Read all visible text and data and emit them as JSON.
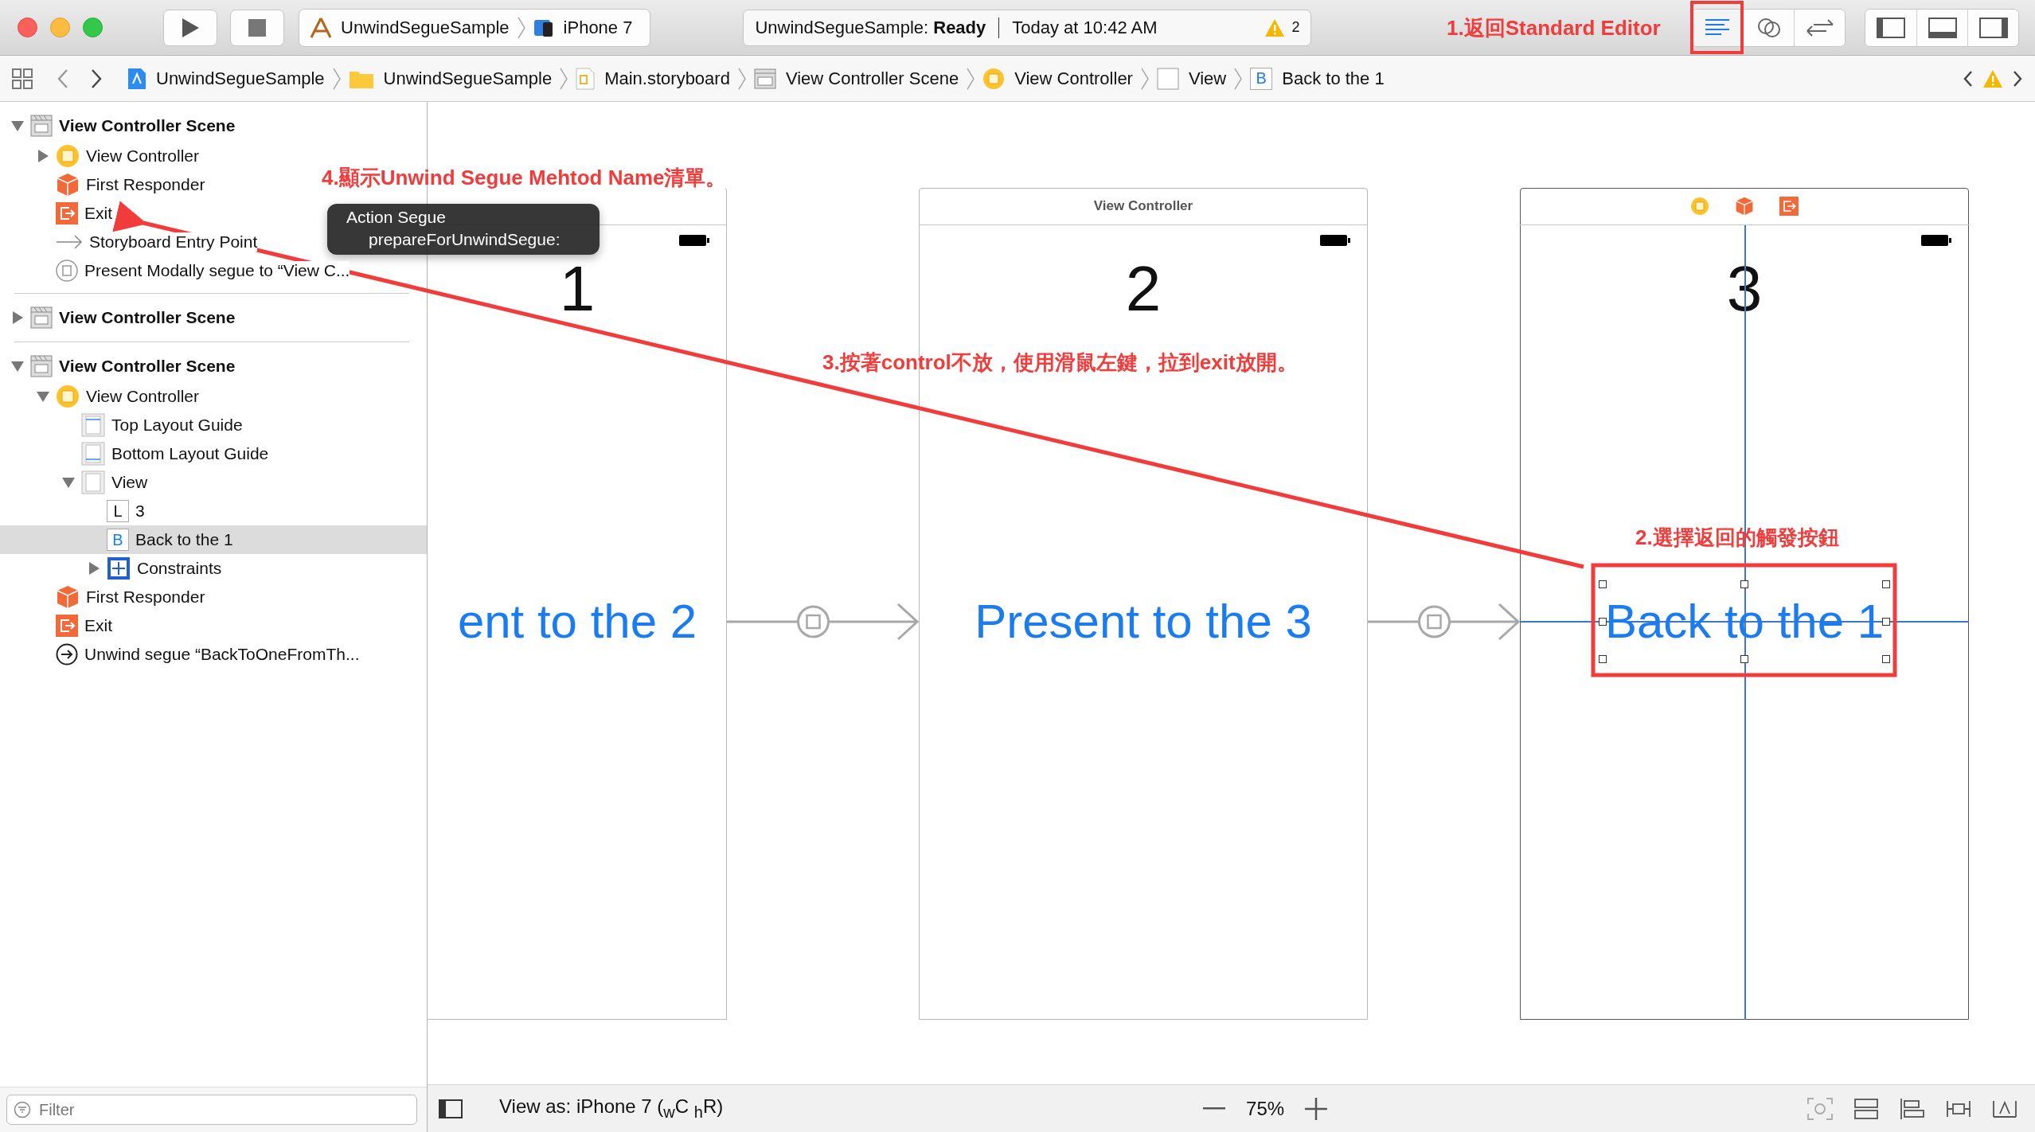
{
  "toolbar": {
    "scheme": "UnwindSegueSample",
    "device": "iPhone 7",
    "activity": {
      "project": "UnwindSegueSample:",
      "status": "Ready",
      "time": "Today at 10:42 AM",
      "warnings": "2"
    },
    "editor_modes": [
      {
        "kind": "standard",
        "selected": true
      },
      {
        "kind": "assistant",
        "selected": false
      },
      {
        "kind": "version",
        "selected": false
      }
    ]
  },
  "jump_bar": [
    {
      "kind": "project",
      "label": "UnwindSegueSample"
    },
    {
      "kind": "folder",
      "label": "UnwindSegueSample"
    },
    {
      "kind": "storyboard",
      "label": "Main.storyboard"
    },
    {
      "kind": "scene",
      "label": "View Controller Scene"
    },
    {
      "kind": "controller",
      "label": "View Controller"
    },
    {
      "kind": "view",
      "label": "View"
    },
    {
      "kind": "button",
      "glyph": "B",
      "label": "Back to the 1"
    }
  ],
  "outline": [
    {
      "kind": "scene",
      "label": "View Controller Scene",
      "expanded": true,
      "selected": false,
      "children": [
        {
          "kind": "controller",
          "label": "View Controller",
          "expanded": false,
          "selected": false
        },
        {
          "kind": "responder",
          "label": "First Responder",
          "selected": false
        },
        {
          "kind": "exit",
          "label": "Exit",
          "selected": false
        },
        {
          "kind": "entry",
          "label": "Storyboard Entry Point",
          "selected": false
        },
        {
          "kind": "segue-modal",
          "label": "Present Modally segue to “View C...",
          "selected": false
        }
      ]
    },
    {
      "kind": "scene",
      "label": "View Controller Scene",
      "expanded": false,
      "selected": false
    },
    {
      "kind": "scene",
      "label": "View Controller Scene",
      "expanded": true,
      "selected": false,
      "children": [
        {
          "kind": "controller",
          "label": "View Controller",
          "expanded": true,
          "selected": false,
          "children": [
            {
              "kind": "guide-top",
              "label": "Top Layout Guide",
              "selected": false
            },
            {
              "kind": "guide-bottom",
              "label": "Bottom Layout Guide",
              "selected": false
            },
            {
              "kind": "view",
              "label": "View",
              "expanded": true,
              "selected": false,
              "children": [
                {
                  "kind": "label",
                  "glyph": "L",
                  "label": "3",
                  "selected": false
                },
                {
                  "kind": "button",
                  "glyph": "B",
                  "label": "Back to the 1",
                  "selected": true
                },
                {
                  "kind": "constraints",
                  "label": "Constraints",
                  "expanded": false,
                  "selected": false
                }
              ]
            }
          ]
        },
        {
          "kind": "responder",
          "label": "First Responder",
          "selected": false
        },
        {
          "kind": "exit",
          "label": "Exit",
          "selected": false
        },
        {
          "kind": "segue-unwind",
          "label": "Unwind segue “BackToOneFromTh...",
          "selected": false
        }
      ]
    }
  ],
  "filter": {
    "placeholder": "Filter"
  },
  "canvas": {
    "scenes": [
      {
        "number": "1",
        "button": "ent to the 2",
        "selected": false,
        "segue_out": true
      },
      {
        "title": "View Controller",
        "number": "2",
        "button": "Present to the 3",
        "selected": false,
        "segue_out": true
      },
      {
        "dock": true,
        "number": "3",
        "button": "Back to the 1",
        "selected": true,
        "segue_out": false
      }
    ]
  },
  "popup": {
    "header": "Action Segue",
    "items": [
      "prepareForUnwindSegue:"
    ]
  },
  "bottom_bar": {
    "view_as": "View as: iPhone 7 ($_{w}$C $_{h}$R)",
    "zoom": "75%"
  },
  "annotations": [
    "1.返回Standard Editor",
    "4.顯示Unwind Segue Mehtod Name清單。",
    "3.按著control不放，使用滑鼠左鍵，拉到exit放開。",
    "2.選擇返回的觸發按鈕"
  ]
}
